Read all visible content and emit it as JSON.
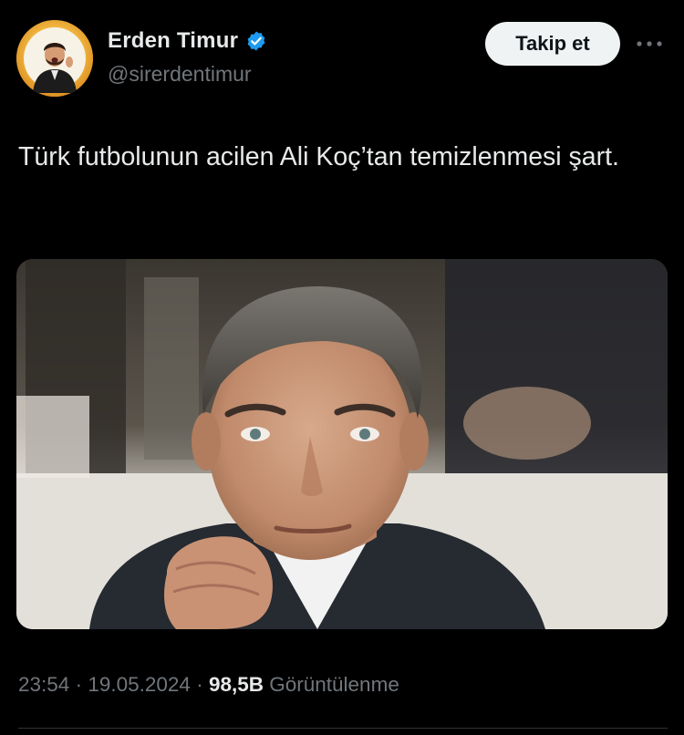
{
  "author": {
    "display_name": "Erden Timur",
    "handle": "@sirerdentimur",
    "verified": true,
    "avatar_icon": "avatar-photo"
  },
  "actions": {
    "follow_label": "Takip et",
    "more_icon": "more-options-icon"
  },
  "tweet": {
    "text": "Türk futbolunun acilen Ali Koç’tan temizlenmesi şart."
  },
  "media": {
    "type": "photo",
    "description_icon": "portrait-photo"
  },
  "meta": {
    "time": "23:54",
    "separator": " · ",
    "date": "19.05.2024",
    "views_count": "98,5B",
    "views_label": "Görüntülenme"
  },
  "colors": {
    "background": "#000000",
    "primary_text": "#e7e9ea",
    "secondary_text": "#71767b",
    "verified_blue": "#1d9bf0",
    "follow_button_bg": "#eff3f4",
    "divider": "#2f3336"
  }
}
